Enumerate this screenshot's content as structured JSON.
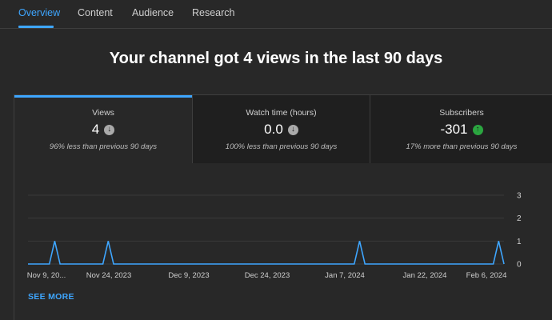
{
  "tabs": [
    {
      "label": "Overview",
      "active": true
    },
    {
      "label": "Content",
      "active": false
    },
    {
      "label": "Audience",
      "active": false
    },
    {
      "label": "Research",
      "active": false
    }
  ],
  "headline": "Your channel got 4 views in the last 90 days",
  "metrics": [
    {
      "label": "Views",
      "value": "4",
      "trend": "down",
      "trend_icon": "arrow-down-circle-icon",
      "comparison": "96% less than previous 90 days"
    },
    {
      "label": "Watch time (hours)",
      "value": "0.0",
      "trend": "down",
      "trend_icon": "arrow-down-circle-icon",
      "comparison": "100% less than previous 90 days"
    },
    {
      "label": "Subscribers",
      "value": "-301",
      "trend": "up",
      "trend_icon": "arrow-up-circle-icon",
      "comparison": "17% more than previous 90 days"
    }
  ],
  "see_more": "SEE MORE",
  "colors": {
    "accent": "#3ea6ff",
    "up": "#2ba640",
    "down": "#aaaaaa",
    "background": "#282828"
  },
  "chart_data": {
    "type": "line",
    "series": [
      {
        "x": [
          "2023-11-09",
          "2023-11-14",
          "2023-11-24",
          "2024-01-10",
          "2024-02-05"
        ],
        "values": [
          0,
          1,
          1,
          1,
          1
        ],
        "note_points": "spike dates, all other days 0"
      }
    ],
    "daily_start": "2023-11-09",
    "daily_end": "2024-02-06",
    "spikes": [
      "2023-11-14",
      "2023-11-24",
      "2024-01-10",
      "2024-02-05"
    ],
    "x_tick_labels": [
      "Nov 9, 20...",
      "Nov 24, 2023",
      "Dec 9, 2023",
      "Dec 24, 2023",
      "Jan 7, 2024",
      "Jan 22, 2024",
      "Feb 6, 2024"
    ],
    "y_ticks": [
      0,
      1,
      2,
      3
    ],
    "ylim": [
      0,
      3
    ],
    "grid": true,
    "line_color": "#3ea6ff"
  }
}
